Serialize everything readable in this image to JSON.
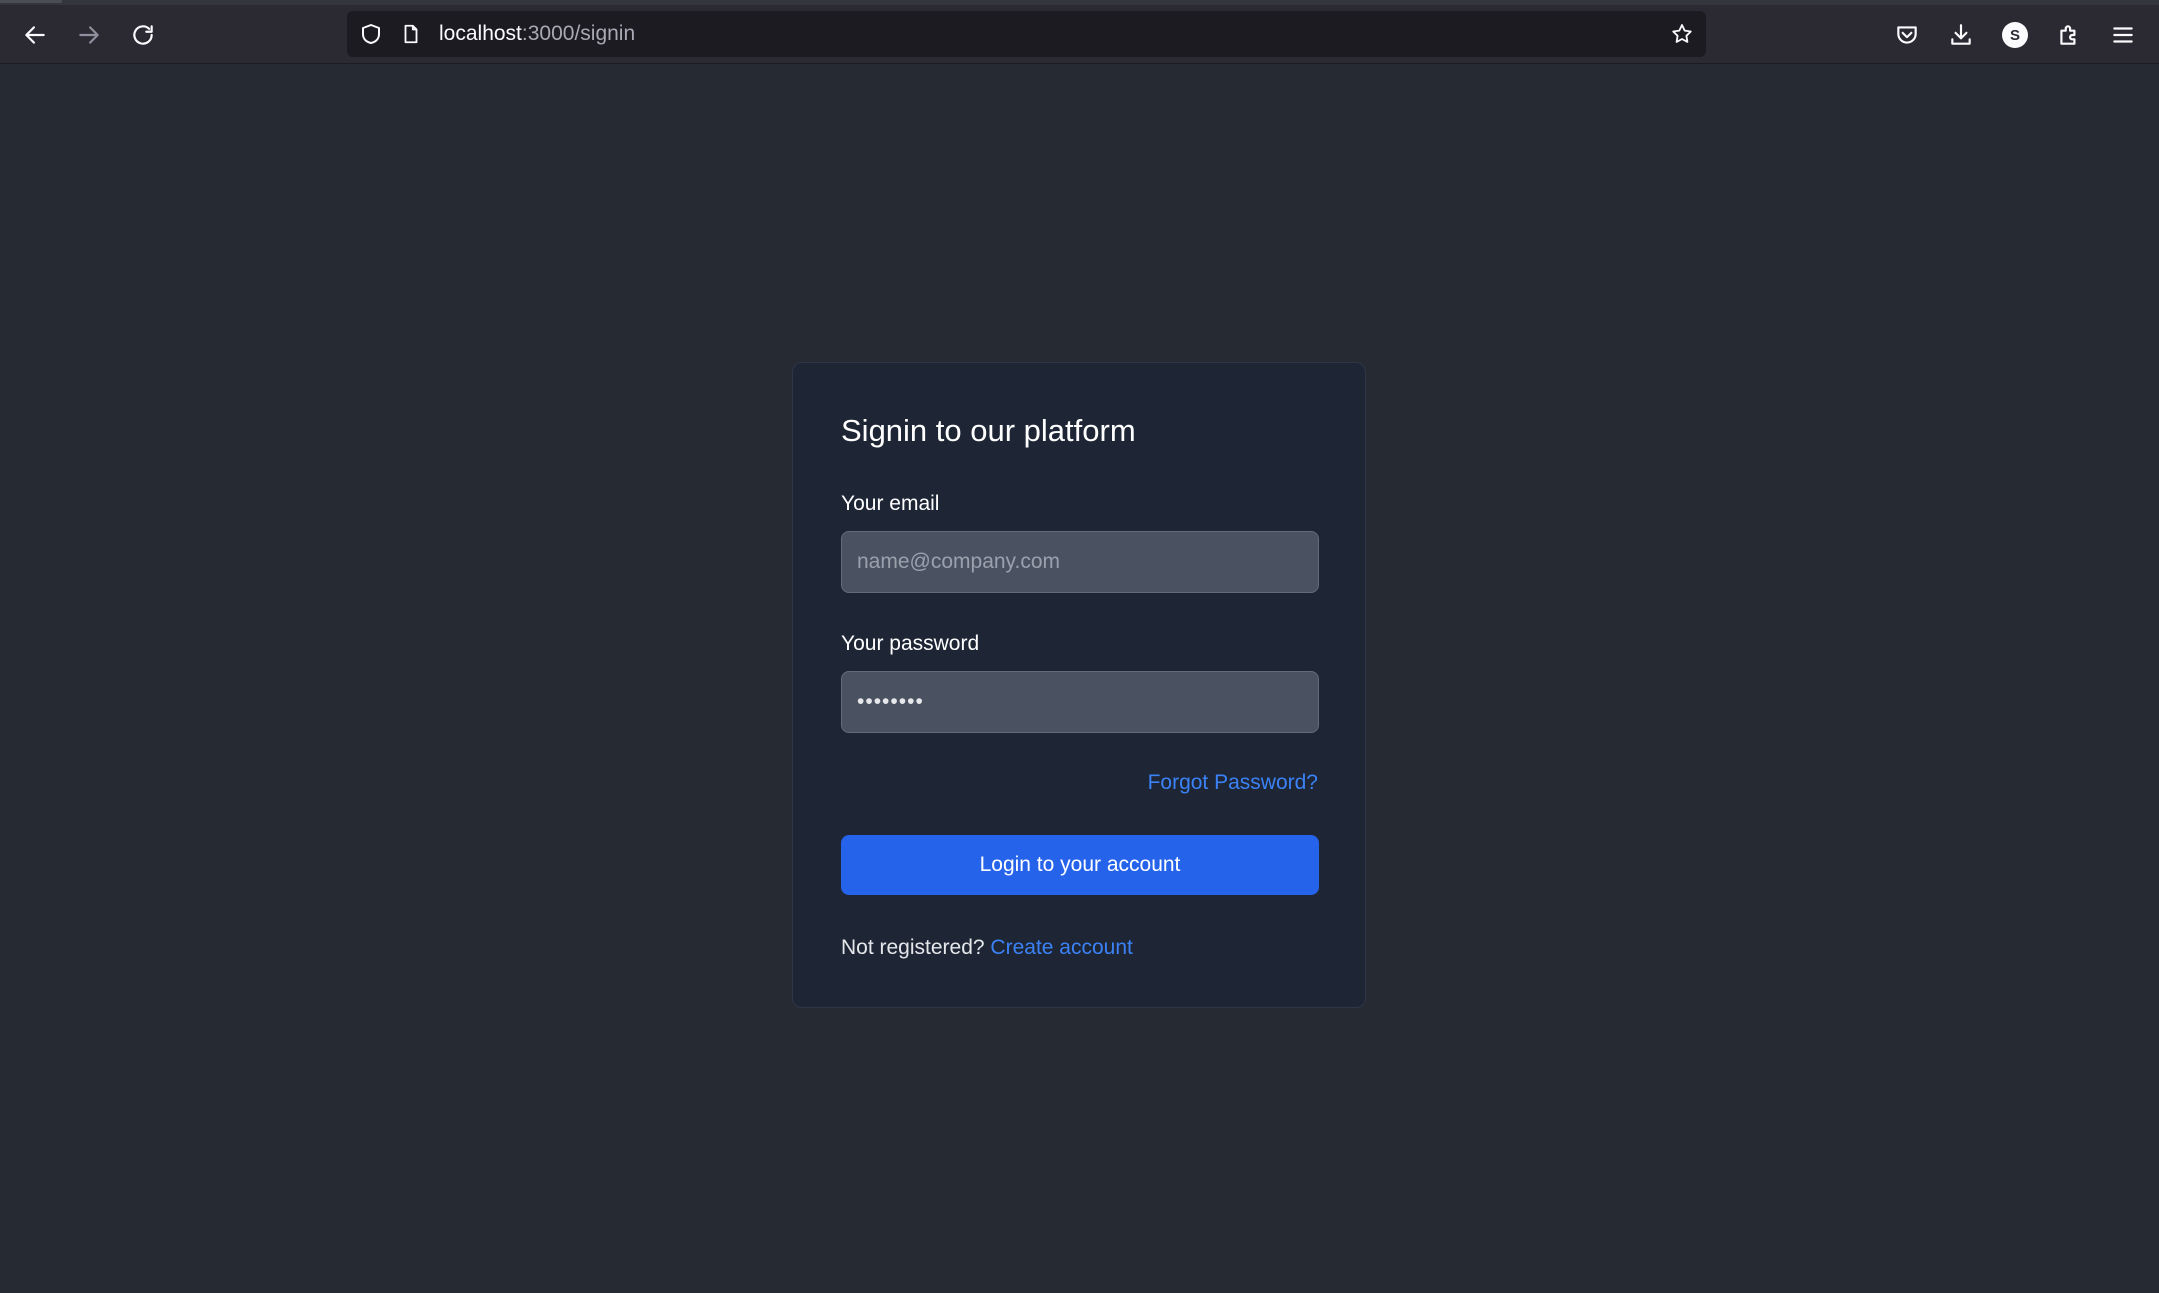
{
  "browser": {
    "url_host": "localhost",
    "url_path": ":3000/signin",
    "avatar_letter": "S",
    "icons": {
      "back": "back-arrow-icon",
      "forward": "forward-arrow-icon",
      "reload": "reload-icon",
      "shield": "shield-icon",
      "page": "page-icon",
      "bookmark": "star-icon",
      "pocket": "pocket-icon",
      "downloads": "download-icon",
      "extensions": "puzzle-icon",
      "menu": "hamburger-menu-icon"
    }
  },
  "signin": {
    "title": "Signin to our platform",
    "email_label": "Your email",
    "email_placeholder": "name@company.com",
    "password_label": "Your password",
    "password_value": "••••••••",
    "forgot_link": "Forgot Password?",
    "login_button": "Login to your account",
    "not_registered": "Not registered?",
    "create_account": "Create account"
  },
  "colors": {
    "page_bg": "#262a33",
    "card_bg": "#1e2636",
    "input_bg": "#4a5262",
    "primary": "#2563eb",
    "link": "#3b82f6"
  }
}
